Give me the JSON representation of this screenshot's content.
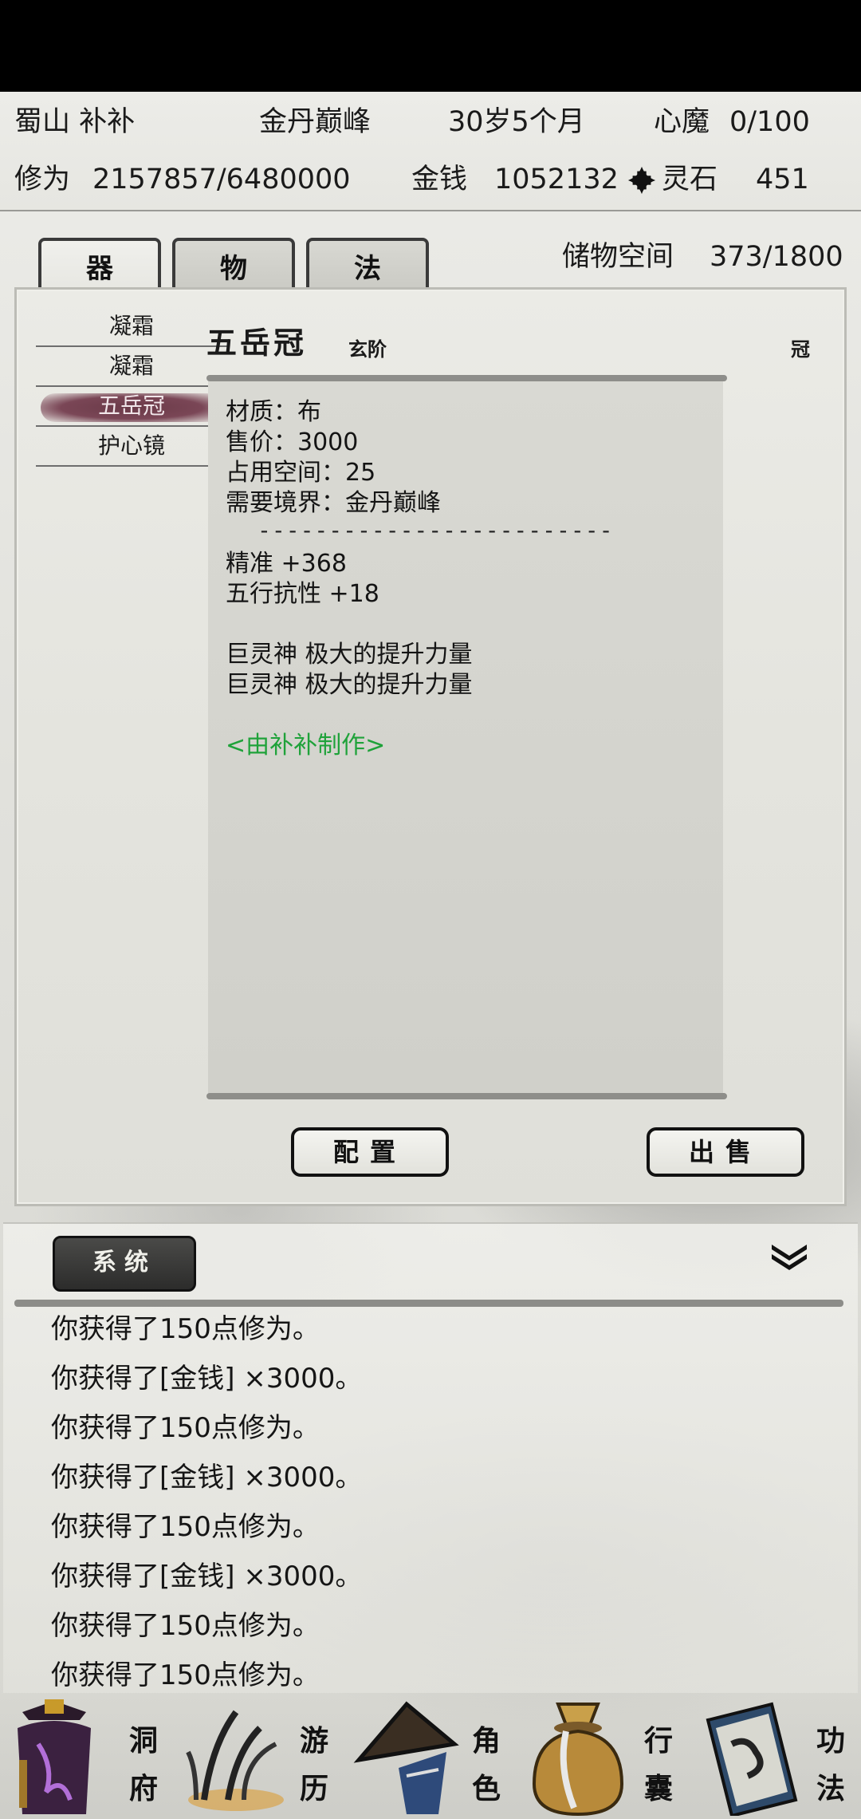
{
  "header": {
    "sect_name": "蜀山 补补",
    "realm": "金丹巅峰",
    "age": "30岁5个月",
    "heart_demon_label": "心魔",
    "heart_demon_value": "0/100",
    "cultivation_label": "修为",
    "cultivation_value": "2157857/6480000",
    "money_label": "金钱",
    "money_value": "1052132",
    "spirit_stone_label": "灵石",
    "spirit_stone_value": "451",
    "spirit_icon": "spirit-stone-icon"
  },
  "tabs": [
    {
      "label": "器",
      "active": true
    },
    {
      "label": "物",
      "active": false
    },
    {
      "label": "法",
      "active": false
    }
  ],
  "storage": {
    "label": "储物空间",
    "value": "373/1800"
  },
  "item_list": [
    {
      "label": "凝霜",
      "selected": false
    },
    {
      "label": "凝霜",
      "selected": false
    },
    {
      "label": "五岳冠",
      "selected": true
    },
    {
      "label": "护心镜",
      "selected": false
    }
  ],
  "detail": {
    "name": "五岳冠",
    "grade": "玄阶",
    "slot": "冠",
    "material": "材质：布",
    "price": "售价：3000",
    "space": "占用空间：25",
    "requirement": "需要境界：金丹巅峰",
    "divider": "-------------------------",
    "stat1": "精准 +368",
    "stat2": "五行抗性 +18",
    "effect1": "巨灵神 极大的提升力量",
    "effect2": "巨灵神 极大的提升力量",
    "maker": "<由补补制作>"
  },
  "actions": {
    "equip": "配置",
    "sell": "出售"
  },
  "log": {
    "tab": "系统",
    "collapse_icon": "double-chevron-down-icon",
    "lines": [
      "你获得了150点修为。",
      "你获得了[金钱] ×3000。",
      "你获得了150点修为。",
      "你获得了[金钱] ×3000。",
      "你获得了150点修为。",
      "你获得了[金钱] ×3000。",
      "你获得了150点修为。",
      "你获得了150点修为。"
    ]
  },
  "nav": [
    {
      "c1": "洞",
      "c2": "府",
      "icon": "pagoda-icon"
    },
    {
      "c1": "游",
      "c2": "历",
      "icon": "grass-icon"
    },
    {
      "c1": "角",
      "c2": "色",
      "icon": "straw-hat-icon"
    },
    {
      "c1": "行",
      "c2": "囊",
      "icon": "pouch-icon"
    },
    {
      "c1": "功",
      "c2": "法",
      "icon": "scroll-book-icon"
    }
  ],
  "colors": {
    "selected_brush": "#7a4656",
    "maker_text": "#1fa23a",
    "system_tab": "#2c2c2b"
  }
}
